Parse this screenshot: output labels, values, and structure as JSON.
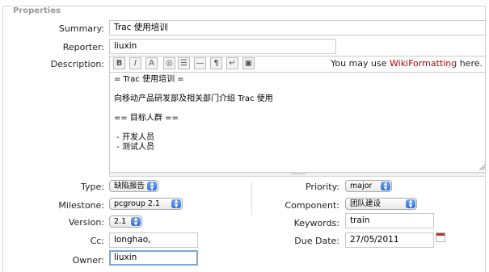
{
  "legend": "Properties",
  "fields": {
    "summary": {
      "label": "Summary:",
      "value": "Trac 使用培训"
    },
    "reporter": {
      "label": "Reporter:",
      "value": "liuxin"
    },
    "description": {
      "label": "Description:",
      "hint_prefix": "You may use ",
      "hint_link": "WikiFormatting",
      "hint_suffix": " here.",
      "lines": [
        "= Trac 使用培训 =",
        "",
        "向移动产品研发部及相关部门介绍 Trac 使用",
        "",
        "== 目标人群 ==",
        "",
        " - 开发人员",
        " - 测试人员"
      ]
    },
    "type": {
      "label": "Type:",
      "value": "缺陷报告"
    },
    "priority": {
      "label": "Priority:",
      "value": "major"
    },
    "milestone": {
      "label": "Milestone:",
      "value": "pcgroup 2.1"
    },
    "component": {
      "label": "Component:",
      "value": "团队建设"
    },
    "version": {
      "label": "Version:",
      "value": "2.1"
    },
    "keywords": {
      "label": "Keywords:",
      "value": "train"
    },
    "cc": {
      "label": "Cc:",
      "value": "longhao,"
    },
    "due_date": {
      "label": "Due Date:",
      "value": "27/05/2011"
    },
    "owner": {
      "label": "Owner:",
      "value": "liuxin"
    }
  },
  "toolbar_icons": [
    "bold-icon",
    "italic-icon",
    "heading-icon",
    "link-icon",
    "code-block-icon",
    "horizontal-rule-icon",
    "paragraph-icon",
    "line-break-icon",
    "image-icon"
  ],
  "toolbar_glyphs": [
    "B",
    "I",
    "A",
    "◎",
    "☰",
    "—",
    "¶",
    "↵",
    "▣"
  ],
  "colors": {
    "accent": "#2b6fe0",
    "link": "#bb0000",
    "calendar": "#cc2d2d"
  }
}
